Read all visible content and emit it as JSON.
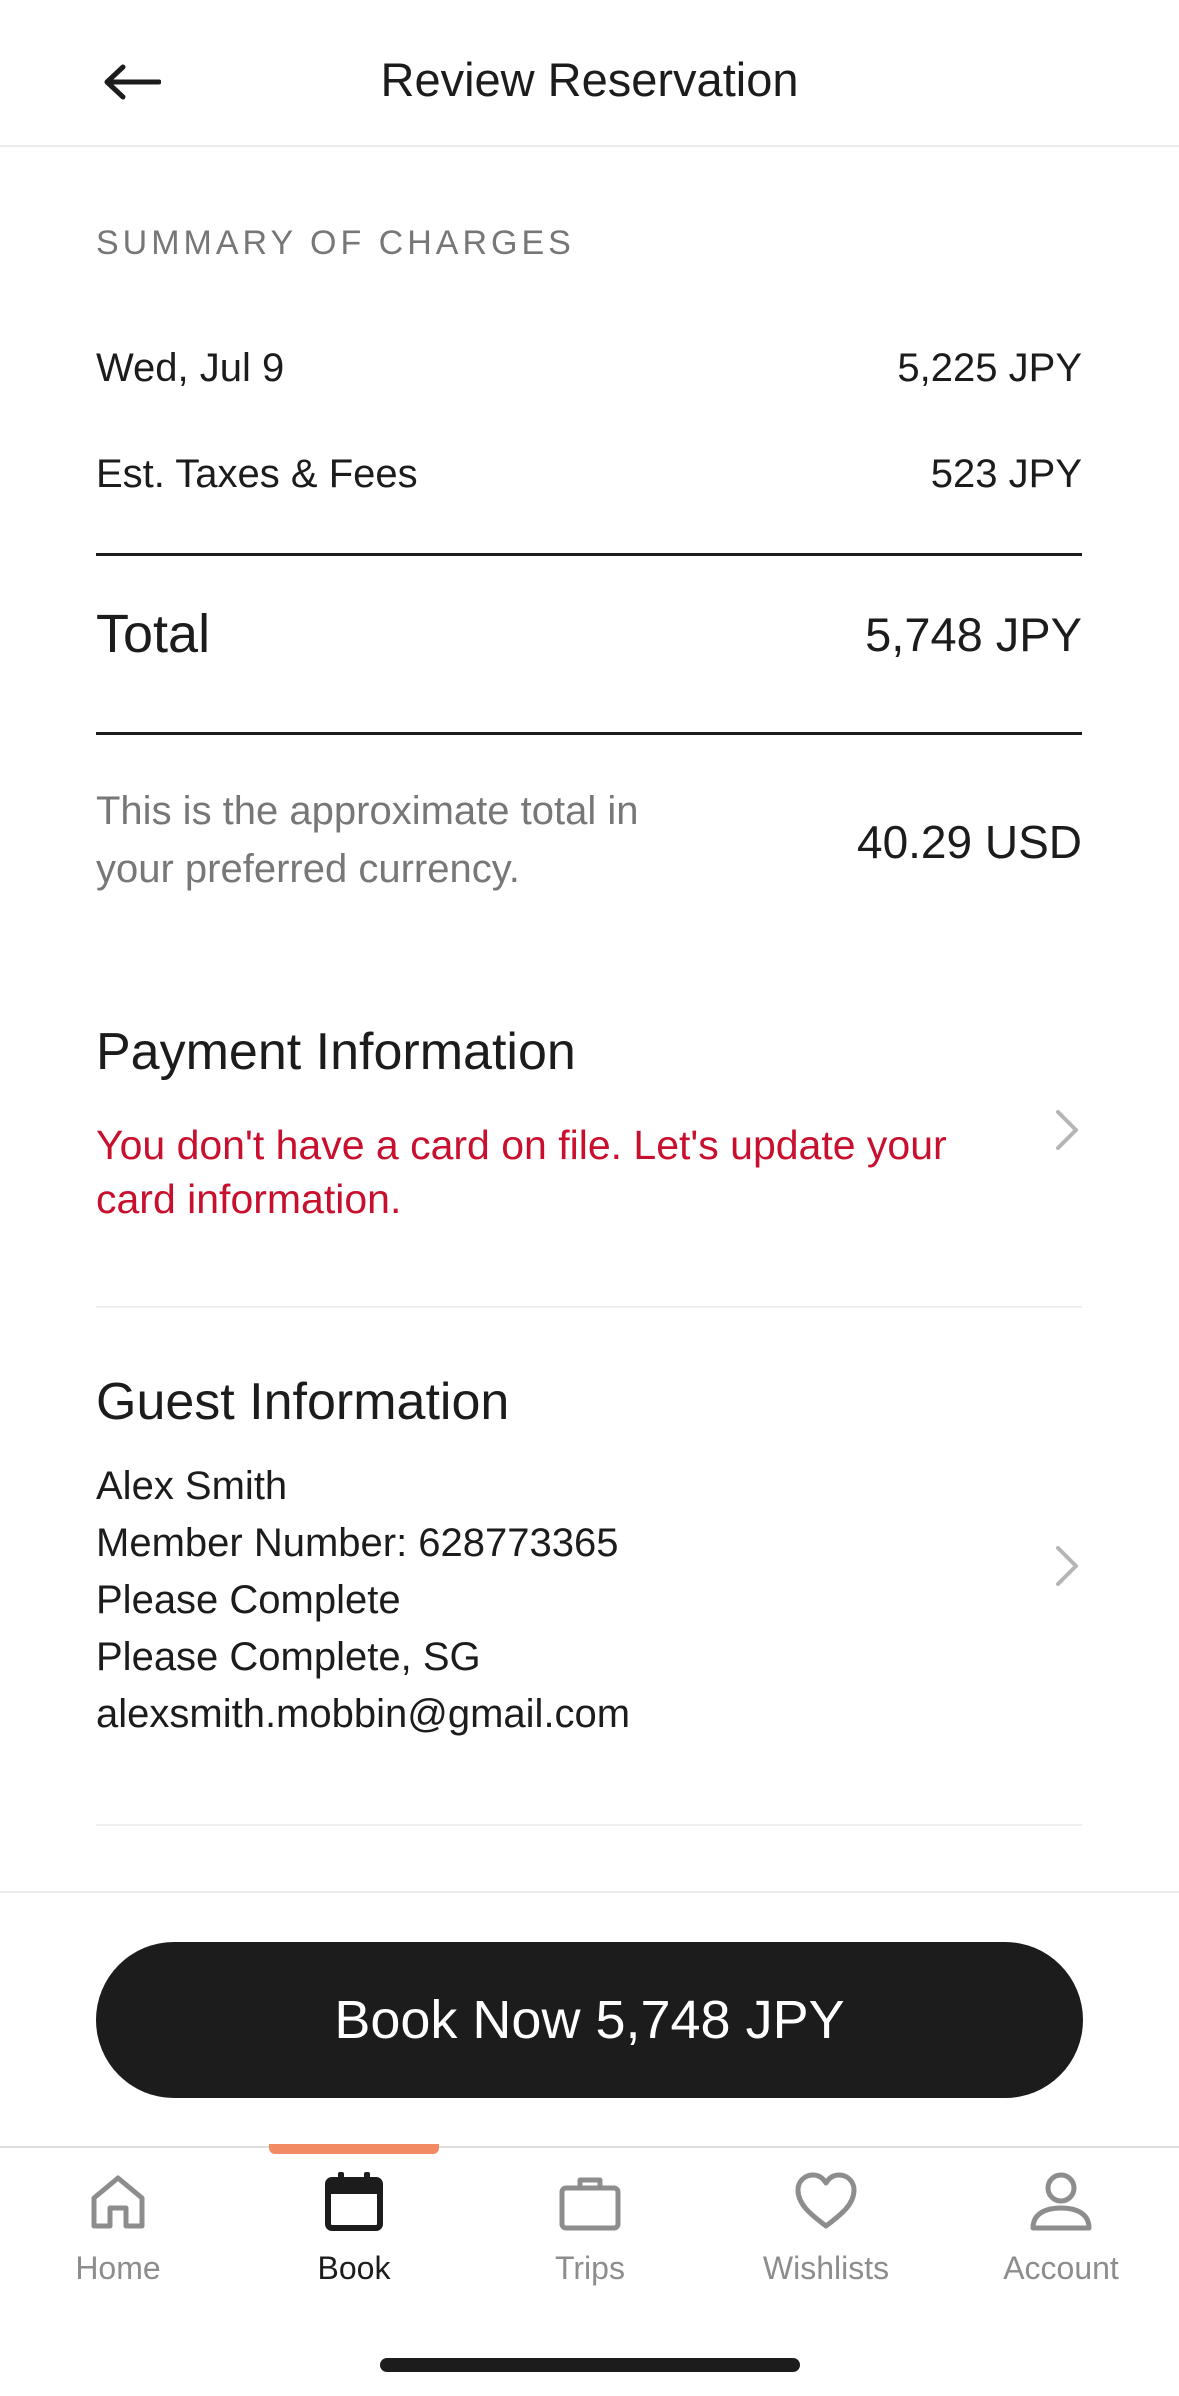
{
  "header": {
    "title": "Review Reservation",
    "back_icon": "arrow-left-icon"
  },
  "summary": {
    "section_label": "SUMMARY OF CHARGES",
    "lines": [
      {
        "label": "Wed, Jul 9",
        "amount": "5,225 JPY"
      },
      {
        "label": "Est. Taxes & Fees",
        "amount": "523 JPY"
      }
    ],
    "total_label": "Total",
    "total_amount": "5,748 JPY",
    "approx_note": "This is the approximate total in your preferred currency.",
    "approx_amount": "40.29 USD"
  },
  "payment": {
    "title": "Payment Information",
    "warning": "You don't have a card on file. Let's update your card information."
  },
  "guest": {
    "title": "Guest Information",
    "lines": [
      "Alex Smith",
      "Member Number: 628773365",
      "Please Complete",
      "Please Complete, SG",
      "alexsmith.mobbin@gmail.com"
    ]
  },
  "book_button": {
    "label": "Book Now 5,748 JPY"
  },
  "tabs": [
    {
      "label": "Home",
      "icon": "home-icon",
      "active": false
    },
    {
      "label": "Book",
      "icon": "calendar-icon",
      "active": true
    },
    {
      "label": "Trips",
      "icon": "briefcase-icon",
      "active": false
    },
    {
      "label": "Wishlists",
      "icon": "heart-icon",
      "active": false
    },
    {
      "label": "Account",
      "icon": "person-icon",
      "active": false
    }
  ],
  "colors": {
    "warning": "#c8102e",
    "tab_indicator": "#f28a63",
    "button": "#1c1c1c"
  }
}
